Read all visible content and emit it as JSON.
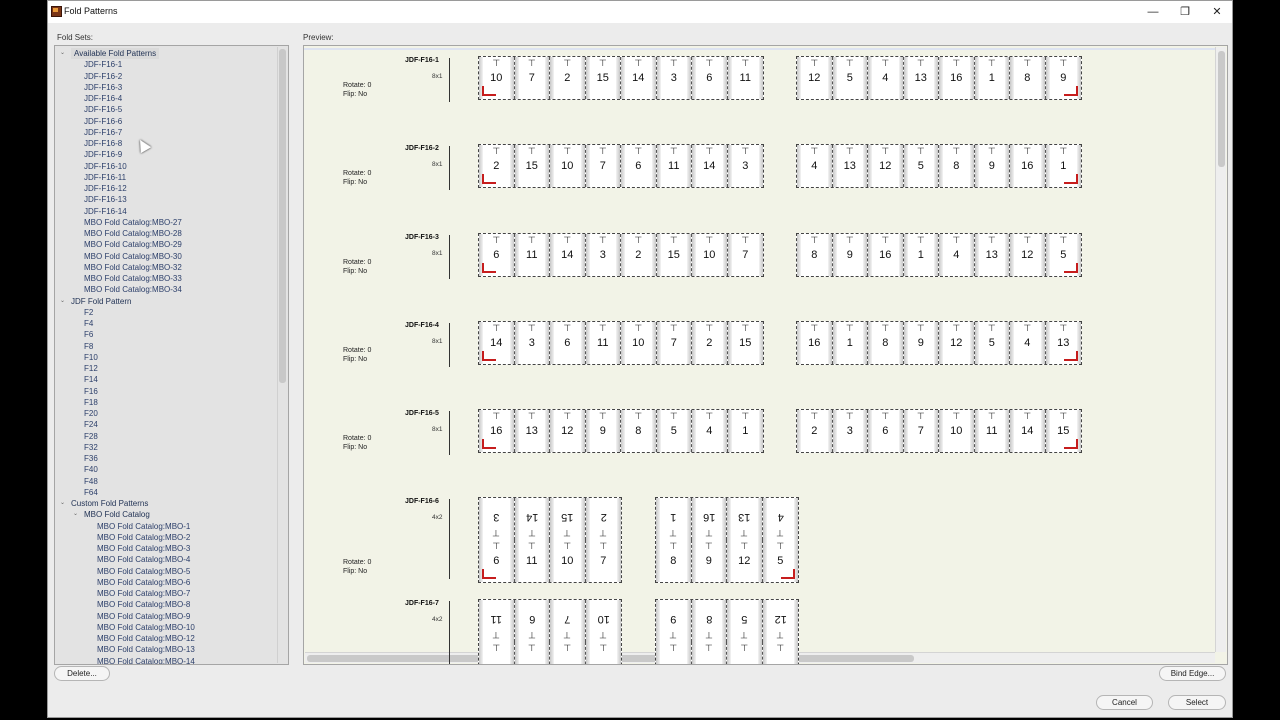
{
  "window": {
    "title": "Fold Patterns",
    "controls": {
      "minimize": "—",
      "maximize": "❐",
      "close": "✕"
    }
  },
  "labels": {
    "fold_sets": "Fold Sets:",
    "preview": "Preview:"
  },
  "tree": [
    {
      "label": "Available Fold Patterns",
      "level": 0,
      "group": true,
      "expanded": true,
      "selected": true
    },
    {
      "label": "JDF-F16-1",
      "level": 1
    },
    {
      "label": "JDF-F16-2",
      "level": 1
    },
    {
      "label": "JDF-F16-3",
      "level": 1
    },
    {
      "label": "JDF-F16-4",
      "level": 1
    },
    {
      "label": "JDF-F16-5",
      "level": 1
    },
    {
      "label": "JDF-F16-6",
      "level": 1
    },
    {
      "label": "JDF-F16-7",
      "level": 1
    },
    {
      "label": "JDF-F16-8",
      "level": 1
    },
    {
      "label": "JDF-F16-9",
      "level": 1
    },
    {
      "label": "JDF-F16-10",
      "level": 1
    },
    {
      "label": "JDF-F16-11",
      "level": 1
    },
    {
      "label": "JDF-F16-12",
      "level": 1
    },
    {
      "label": "JDF-F16-13",
      "level": 1
    },
    {
      "label": "JDF-F16-14",
      "level": 1
    },
    {
      "label": "MBO Fold Catalog:MBO-27",
      "level": 1
    },
    {
      "label": "MBO Fold Catalog:MBO-28",
      "level": 1
    },
    {
      "label": "MBO Fold Catalog:MBO-29",
      "level": 1
    },
    {
      "label": "MBO Fold Catalog:MBO-30",
      "level": 1
    },
    {
      "label": "MBO Fold Catalog:MBO-32",
      "level": 1
    },
    {
      "label": "MBO Fold Catalog:MBO-33",
      "level": 1
    },
    {
      "label": "MBO Fold Catalog:MBO-34",
      "level": 1
    },
    {
      "label": "JDF Fold Pattern",
      "level": 0,
      "group": true,
      "expanded": true
    },
    {
      "label": "F2",
      "level": 1
    },
    {
      "label": "F4",
      "level": 1
    },
    {
      "label": "F6",
      "level": 1
    },
    {
      "label": "F8",
      "level": 1
    },
    {
      "label": "F10",
      "level": 1
    },
    {
      "label": "F12",
      "level": 1
    },
    {
      "label": "F14",
      "level": 1
    },
    {
      "label": "F16",
      "level": 1
    },
    {
      "label": "F18",
      "level": 1
    },
    {
      "label": "F20",
      "level": 1
    },
    {
      "label": "F24",
      "level": 1
    },
    {
      "label": "F28",
      "level": 1
    },
    {
      "label": "F32",
      "level": 1
    },
    {
      "label": "F36",
      "level": 1
    },
    {
      "label": "F40",
      "level": 1
    },
    {
      "label": "F48",
      "level": 1
    },
    {
      "label": "F64",
      "level": 1
    },
    {
      "label": "Custom Fold Patterns",
      "level": 0,
      "group": true,
      "expanded": true
    },
    {
      "label": "MBO Fold Catalog",
      "level": 1,
      "group": true,
      "expanded": true
    },
    {
      "label": "MBO Fold Catalog:MBO-1",
      "level": 2
    },
    {
      "label": "MBO Fold Catalog:MBO-2",
      "level": 2
    },
    {
      "label": "MBO Fold Catalog:MBO-3",
      "level": 2
    },
    {
      "label": "MBO Fold Catalog:MBO-4",
      "level": 2
    },
    {
      "label": "MBO Fold Catalog:MBO-5",
      "level": 2
    },
    {
      "label": "MBO Fold Catalog:MBO-6",
      "level": 2
    },
    {
      "label": "MBO Fold Catalog:MBO-7",
      "level": 2
    },
    {
      "label": "MBO Fold Catalog:MBO-8",
      "level": 2
    },
    {
      "label": "MBO Fold Catalog:MBO-9",
      "level": 2
    },
    {
      "label": "MBO Fold Catalog:MBO-10",
      "level": 2
    },
    {
      "label": "MBO Fold Catalog:MBO-12",
      "level": 2
    },
    {
      "label": "MBO Fold Catalog:MBO-13",
      "level": 2
    },
    {
      "label": "MBO Fold Catalog:MBO-14",
      "level": 2
    }
  ],
  "patterns": [
    {
      "name": "JDF-F16-1",
      "dims": "8x1",
      "rotate": "Rotate: 0",
      "flip": "Flip: No",
      "front": [
        [
          10,
          7,
          2,
          15,
          14,
          3,
          6,
          11
        ]
      ],
      "back": [
        [
          12,
          5,
          4,
          13,
          16,
          1,
          8,
          9
        ]
      ]
    },
    {
      "name": "JDF-F16-2",
      "dims": "8x1",
      "rotate": "Rotate: 0",
      "flip": "Flip: No",
      "front": [
        [
          2,
          15,
          10,
          7,
          6,
          11,
          14,
          3
        ]
      ],
      "back": [
        [
          4,
          13,
          12,
          5,
          8,
          9,
          16,
          1
        ]
      ]
    },
    {
      "name": "JDF-F16-3",
      "dims": "8x1",
      "rotate": "Rotate: 0",
      "flip": "Flip: No",
      "front": [
        [
          6,
          11,
          14,
          3,
          2,
          15,
          10,
          7
        ]
      ],
      "back": [
        [
          8,
          9,
          16,
          1,
          4,
          13,
          12,
          5
        ]
      ]
    },
    {
      "name": "JDF-F16-4",
      "dims": "8x1",
      "rotate": "Rotate: 0",
      "flip": "Flip: No",
      "front": [
        [
          14,
          3,
          6,
          11,
          10,
          7,
          2,
          15
        ]
      ],
      "back": [
        [
          16,
          1,
          8,
          9,
          12,
          5,
          4,
          13
        ]
      ]
    },
    {
      "name": "JDF-F16-5",
      "dims": "8x1",
      "rotate": "Rotate: 0",
      "flip": "Flip: No",
      "front": [
        [
          16,
          13,
          12,
          9,
          8,
          5,
          4,
          1
        ]
      ],
      "back": [
        [
          2,
          3,
          6,
          7,
          10,
          11,
          14,
          15
        ]
      ]
    },
    {
      "name": "JDF-F16-6",
      "dims": "4x2",
      "rotate": "Rotate: 0",
      "flip": "Flip: No",
      "front": [
        [
          3,
          14,
          15,
          2
        ],
        [
          6,
          11,
          10,
          7
        ]
      ],
      "back": [
        [
          1,
          16,
          13,
          4
        ],
        [
          8,
          9,
          12,
          5
        ]
      ]
    },
    {
      "name": "JDF-F16-7",
      "dims": "4x2",
      "rotate": "",
      "flip": "",
      "front": [
        [
          11,
          6,
          7,
          10
        ],
        [
          null,
          null,
          null,
          null
        ]
      ],
      "back": [
        [
          9,
          8,
          5,
          12
        ],
        [
          null,
          null,
          null,
          null
        ]
      ]
    }
  ],
  "buttons": {
    "delete": "Delete...",
    "bind_edge": "Bind Edge...",
    "cancel": "Cancel",
    "select": "Select"
  },
  "icons": {
    "fold_mark": "⊤"
  },
  "colors": {
    "preview_bg": "#f2f3e7",
    "corner_mark": "#c61d1d",
    "tree_text": "#2c3f6a"
  }
}
